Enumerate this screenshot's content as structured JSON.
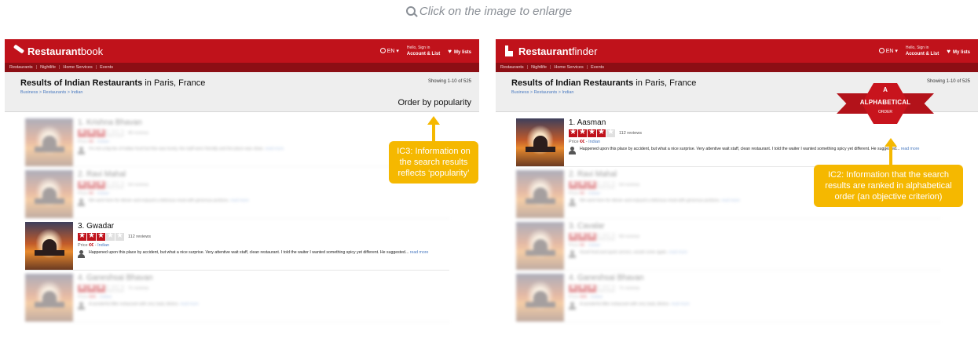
{
  "hint": {
    "text": "Click on the image to enlarge",
    "icon": "zoom-icon"
  },
  "left": {
    "brand": {
      "bold": "Restaurant",
      "rest": "book"
    },
    "topbar": {
      "lang": "EN",
      "hello": "Hello, Sign in",
      "account": "Account & List",
      "lists": "My lists"
    },
    "subnav": [
      "Restaurants",
      "Nightlife",
      "Home Services",
      "Events"
    ],
    "results_title_bold": "Results of Indian Restaurants",
    "results_title_rest": " in Paris, France",
    "breadcrumb": "Business > Restaurants > Indian",
    "showing": "Showing 1-10 of 525",
    "order": "Order by popularity",
    "items": [
      {
        "name": "1. Krishna Bhavan",
        "stars": 3,
        "reviews": "89 reviews",
        "price_label": "Price",
        "price": "€€",
        "cuisine": "Indian",
        "text": "I'm not a big fan of indian food but this was lovely, the staff were friendly and the place was clean.",
        "more": "read more",
        "blurred": true
      },
      {
        "name": "2. Ravi Mahal",
        "stars": 3,
        "reviews": "64 reviews",
        "price_label": "Price",
        "price": "€€",
        "cuisine": "Indian",
        "text": "We went here for dinner and enjoyed a delicious meal with generous portions.",
        "more": "read more",
        "blurred": true
      },
      {
        "name": "3. Gwadar",
        "stars": 3,
        "reviews": "112 reviews",
        "price_label": "Price",
        "price": "€€",
        "cuisine": "Indian",
        "text": "Happened upon this place by accident, but what a nice surprise. Very attentive wait staff, clean restaurant. I told the waiter I wanted something spicy yet different. He suggested...",
        "more": "read more",
        "blurred": false
      },
      {
        "name": "4. Ganeshsai Bhavan",
        "stars": 3,
        "reviews": "71 reviews",
        "price_label": "Price",
        "price": "€€€",
        "cuisine": "Indian",
        "text": "A wonderful little restaurant with very tasty dishes.",
        "more": "read more",
        "blurred": true
      }
    ]
  },
  "right": {
    "brand": {
      "bold": "Restaurant",
      "rest": "finder"
    },
    "topbar": {
      "lang": "EN",
      "hello": "Hello, Sign in",
      "account": "Account & List",
      "lists": "My lists"
    },
    "subnav": [
      "Restaurants",
      "Nightlife",
      "Home Services",
      "Events"
    ],
    "results_title_bold": "Results of Indian Restaurants",
    "results_title_rest": " in Paris, France",
    "breadcrumb": "Business > Restaurants > Indian",
    "showing": "Showing 1-10 of 525",
    "ribbon": {
      "letter": "A",
      "word": "ALPHABETICAL",
      "order": "ORDER"
    },
    "items": [
      {
        "name": "1. Aasman",
        "stars": 4,
        "reviews": "112 reviews",
        "price_label": "Price",
        "price": "€€",
        "cuisine": "Indian",
        "text": "Happened upon this place by accident, but what a nice surprise. Very attentive wait staff, clean restaurant. I told the waiter I wanted something spicy yet different. He suggested...",
        "more": "read more",
        "blurred": false
      },
      {
        "name": "2. Ravi Mahal",
        "stars": 3,
        "reviews": "64 reviews",
        "price_label": "Price",
        "price": "€€",
        "cuisine": "Indian",
        "text": "We went here for dinner and enjoyed a delicious meal with generous portions.",
        "more": "read more",
        "blurred": true
      },
      {
        "name": "3. Cavalar",
        "stars": 3,
        "reviews": "58 reviews",
        "price_label": "Price",
        "price": "€€",
        "cuisine": "Indian",
        "text": "Good food and quick service, would come again.",
        "more": "read more",
        "blurred": true
      },
      {
        "name": "4. Ganeshsai Bhavan",
        "stars": 3,
        "reviews": "71 reviews",
        "price_label": "Price",
        "price": "€€€",
        "cuisine": "Indian",
        "text": "A wonderful little restaurant with very tasty dishes.",
        "more": "read more",
        "blurred": true
      }
    ]
  },
  "callouts": {
    "ic3": "IC3: Information on the search results reflects ‘popularity’",
    "ic2": "IC2: Information  that the search results are ranked in alphabetical order (an objective criterion)"
  },
  "colors": {
    "brand_red": "#c0121b",
    "callout_yellow": "#f5b800",
    "link_blue": "#4a7ac0"
  }
}
